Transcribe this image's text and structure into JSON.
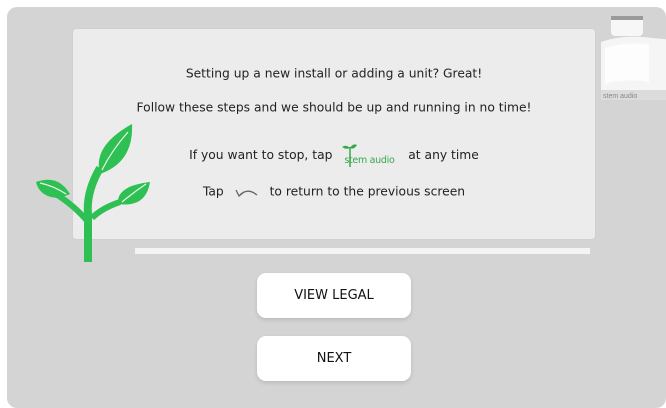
{
  "intro": {
    "line1": "Setting up a new install or adding a unit? Great!",
    "line2": "Follow these steps and we should be up and running in no time!",
    "line3_before": "If you want to stop, tap",
    "line3_logo": "stem audio",
    "line3_after": "at any time",
    "line4_before": "Tap",
    "line4_after": "to return to the previous screen"
  },
  "device_label": "stem audio",
  "buttons": {
    "legal": "VIEW LEGAL",
    "next": "NEXT"
  },
  "progress": {
    "fraction": 1.0
  },
  "colors": {
    "brand_green": "#34a94b",
    "background": "#d4d4d4",
    "card": "#ececec"
  },
  "icons": {
    "stop": "stem-audio-logo-icon",
    "back": "back-arrow-icon",
    "plant": "plant-sprout-icon"
  }
}
